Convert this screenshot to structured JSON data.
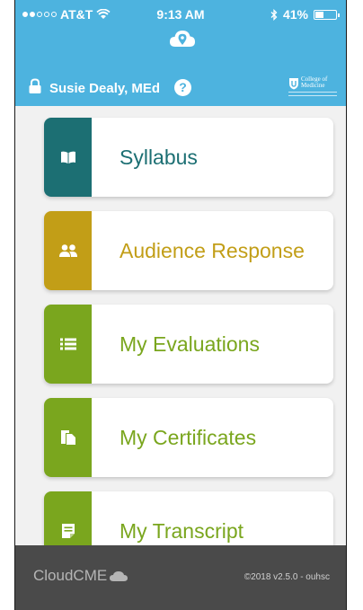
{
  "status_bar": {
    "carrier": "AT&T",
    "time": "9:13 AM",
    "battery": "41%",
    "battery_level": 0.41,
    "signal_bars": 2
  },
  "header": {
    "logo_icon": "cloud-location-icon",
    "user_name": "Susie Dealy, MEd",
    "help_label": "?",
    "college_logo": {
      "line1": "College of",
      "line2": "Medicine"
    }
  },
  "menu": {
    "items": [
      {
        "label": "Syllabus",
        "icon": "book-icon",
        "color": "#1c6f73"
      },
      {
        "label": "Audience Response",
        "icon": "people-icon",
        "color": "#c29e17"
      },
      {
        "label": "My Evaluations",
        "icon": "list-icon",
        "color": "#7aa61e"
      },
      {
        "label": "My Certificates",
        "icon": "certificates-icon",
        "color": "#7aa61e"
      },
      {
        "label": "My Transcript",
        "icon": "transcript-icon",
        "color": "#7aa61e"
      }
    ]
  },
  "footer": {
    "brand": "CloudCME",
    "version": "©2018 v2.5.0 - ouhsc"
  }
}
